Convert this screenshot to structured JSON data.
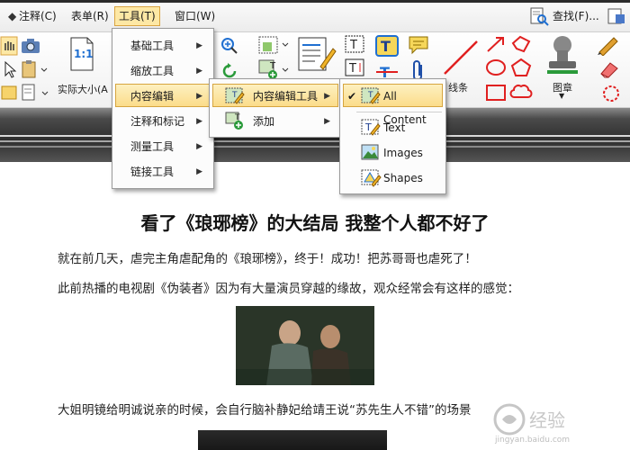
{
  "menubar": {
    "items": [
      {
        "label": "注释(C)"
      },
      {
        "label": "表单(R)"
      },
      {
        "label": "工具(T)"
      },
      {
        "label": "窗口(W)"
      }
    ],
    "find_label": "查找(F)..."
  },
  "ribbon": {
    "actual_size_icon_text": "1:1",
    "actual_size_label": "实际大小(A",
    "line_label": "线条",
    "stamp_label": "图章"
  },
  "tools_menu": {
    "items": [
      {
        "label": "基础工具"
      },
      {
        "label": "缩放工具"
      },
      {
        "label": "内容编辑"
      },
      {
        "label": "注释和标记"
      },
      {
        "label": "测量工具"
      },
      {
        "label": "链接工具"
      }
    ]
  },
  "content_edit_menu": {
    "items": [
      {
        "label": "内容编辑工具"
      },
      {
        "label": "添加"
      }
    ]
  },
  "content_edit_tools_menu": {
    "items": [
      {
        "label": "All Content",
        "checked": true
      },
      {
        "label": "Text"
      },
      {
        "label": "Images"
      },
      {
        "label": "Shapes"
      }
    ]
  },
  "document": {
    "title": "看了《琅琊榜》的大结局 我整个人都不好了",
    "paragraphs": [
      "就在前几天，虐完主角虐配角的《琅琊榜》，终于！成功！把苏哥哥也虐死了！",
      "此前热播的电视剧《伪装者》因为有大量演员穿越的缘故，观众经常会有这样的感觉：",
      "大姐明镜给明诚说亲的时候，会自行脑补静妃给靖王说“苏先生人不错”的场景"
    ]
  },
  "watermark": {
    "text": "jingyan.baidu.com"
  },
  "colors": {
    "highlight": "#fbdc8a",
    "highlight_border": "#d6a53f",
    "accent_blue": "#1f6fd1",
    "accent_red": "#e02020"
  }
}
